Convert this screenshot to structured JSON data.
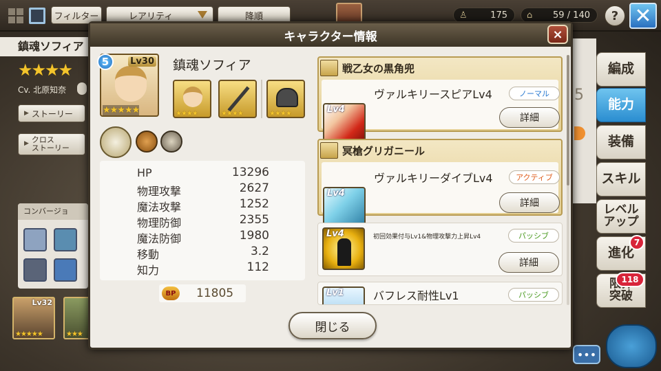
{
  "topbar": {
    "filter_label": "フィルター",
    "rarity_label": "レアリティ",
    "sort_label": "降順",
    "units_count": "175",
    "capacity": "59 / 140",
    "help_label": "?"
  },
  "background": {
    "char_name": "鎮魂ソフィア",
    "cv": "Cv. 北原知奈",
    "story_label": "ストーリー",
    "cross_story_label": "クロス\nストーリー",
    "conversion_label": "コンバージョ",
    "card1_lv": "Lv32",
    "side_peek_number": "5"
  },
  "side_tabs": [
    {
      "label": "編成"
    },
    {
      "label": "能力"
    },
    {
      "label": "装備"
    },
    {
      "label": "スキル"
    },
    {
      "label": "レベル\nアップ"
    },
    {
      "label": "進化"
    },
    {
      "label": "限界\n突破"
    }
  ],
  "badges": {
    "evolve": "7",
    "limit_break": "118"
  },
  "modal": {
    "title": "キャラクター情報",
    "close_x": "×",
    "character": {
      "rank": "5",
      "level": "Lv30",
      "name": "鎮魂ソフィア",
      "stars": "★★★★★",
      "slot_stars": "★★★★"
    },
    "stats": [
      {
        "label": "HP",
        "value": "13296"
      },
      {
        "label": "物理攻撃",
        "value": "2627"
      },
      {
        "label": "魔法攻撃",
        "value": "1252"
      },
      {
        "label": "物理防御",
        "value": "2355"
      },
      {
        "label": "魔法防御",
        "value": "1980"
      },
      {
        "label": "移動",
        "value": "3.2"
      },
      {
        "label": "知力",
        "value": "112"
      }
    ],
    "bp_label": "BP",
    "bp_value": "11805",
    "skills": [
      {
        "header": "戦乙女の黒角兜",
        "lv": "Lv4",
        "name": "ヴァルキリースピアLv4",
        "type": "ノーマル",
        "detail": "詳細"
      },
      {
        "header": "冥槍グリガニール",
        "lv": "Lv4",
        "name": "ヴァルキリーダイブLv4",
        "type": "アクティブ",
        "detail": "詳細"
      },
      {
        "lv": "Lv4",
        "name": "初回効果付与Lv1&物理攻撃力上昇Lv4",
        "type": "パッシブ",
        "detail": "詳細"
      },
      {
        "lv": "Lv1",
        "name": "バフレス耐性Lv1",
        "type": "パッシブ"
      }
    ],
    "close_label": "閉じる"
  },
  "colors": {
    "accent_blue": "#2a8dd0",
    "badge_red": "#d8243a",
    "gold": "#e4cf92"
  }
}
